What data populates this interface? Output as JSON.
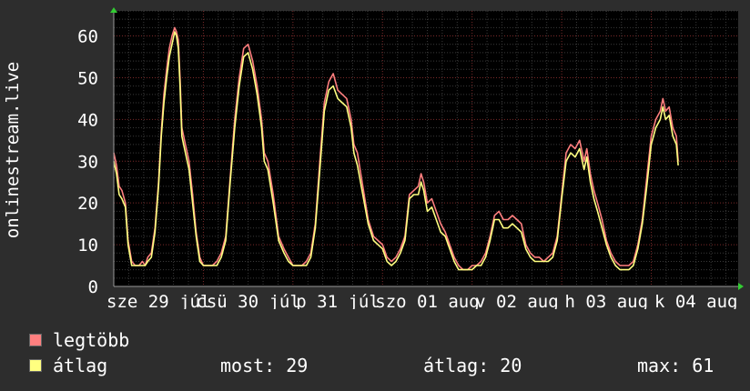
{
  "chart_data": {
    "type": "line",
    "ylabel": "onlinestream.live",
    "ylim": [
      0,
      66
    ],
    "yticks": [
      0,
      10,
      20,
      30,
      40,
      50,
      60
    ],
    "xticks": [
      {
        "label": "sze 29 júl",
        "at": 0.5
      },
      {
        "label": "csü 30 júl",
        "at": 1.5
      },
      {
        "label": "p 31 júl",
        "at": 2.5
      },
      {
        "label": "szo 01 aug",
        "at": 3.5
      },
      {
        "label": "v 02 aug",
        "at": 4.5
      },
      {
        "label": "h 03 aug",
        "at": 5.5
      },
      {
        "label": "k 04 aug",
        "at": 6.5
      }
    ],
    "xlim": [
      0,
      6.97
    ],
    "grid": true,
    "series": [
      {
        "name": "legtöbb",
        "color": "#ff7f7f",
        "points": [
          [
            0.0,
            32
          ],
          [
            0.03,
            29
          ],
          [
            0.06,
            24
          ],
          [
            0.09,
            23
          ],
          [
            0.13,
            20
          ],
          [
            0.16,
            11
          ],
          [
            0.2,
            6
          ],
          [
            0.24,
            5
          ],
          [
            0.28,
            5
          ],
          [
            0.32,
            6
          ],
          [
            0.35,
            5
          ],
          [
            0.38,
            7
          ],
          [
            0.42,
            8
          ],
          [
            0.46,
            14
          ],
          [
            0.5,
            25
          ],
          [
            0.53,
            37
          ],
          [
            0.56,
            46
          ],
          [
            0.59,
            52
          ],
          [
            0.62,
            57
          ],
          [
            0.65,
            60
          ],
          [
            0.68,
            62
          ],
          [
            0.7,
            61
          ],
          [
            0.72,
            59
          ],
          [
            0.74,
            50
          ],
          [
            0.76,
            38
          ],
          [
            0.8,
            34
          ],
          [
            0.84,
            30
          ],
          [
            0.88,
            22
          ],
          [
            0.92,
            13
          ],
          [
            0.96,
            7
          ],
          [
            1.0,
            5
          ],
          [
            1.05,
            5
          ],
          [
            1.1,
            5
          ],
          [
            1.15,
            6
          ],
          [
            1.2,
            8
          ],
          [
            1.25,
            12
          ],
          [
            1.3,
            26
          ],
          [
            1.35,
            40
          ],
          [
            1.4,
            50
          ],
          [
            1.45,
            57
          ],
          [
            1.5,
            58
          ],
          [
            1.55,
            54
          ],
          [
            1.6,
            48
          ],
          [
            1.65,
            40
          ],
          [
            1.68,
            32
          ],
          [
            1.72,
            30
          ],
          [
            1.78,
            22
          ],
          [
            1.84,
            12
          ],
          [
            1.9,
            9
          ],
          [
            1.95,
            7
          ],
          [
            2.0,
            5
          ],
          [
            2.05,
            5
          ],
          [
            2.1,
            5
          ],
          [
            2.15,
            6
          ],
          [
            2.2,
            8
          ],
          [
            2.25,
            15
          ],
          [
            2.3,
            30
          ],
          [
            2.35,
            44
          ],
          [
            2.4,
            49
          ],
          [
            2.45,
            51
          ],
          [
            2.5,
            47
          ],
          [
            2.55,
            46
          ],
          [
            2.6,
            45
          ],
          [
            2.65,
            40
          ],
          [
            2.68,
            34
          ],
          [
            2.72,
            32
          ],
          [
            2.78,
            24
          ],
          [
            2.84,
            16
          ],
          [
            2.9,
            12
          ],
          [
            2.95,
            11
          ],
          [
            3.0,
            10
          ],
          [
            3.05,
            7
          ],
          [
            3.1,
            6
          ],
          [
            3.15,
            7
          ],
          [
            3.2,
            9
          ],
          [
            3.25,
            12
          ],
          [
            3.3,
            22
          ],
          [
            3.35,
            23
          ],
          [
            3.4,
            24
          ],
          [
            3.43,
            27
          ],
          [
            3.46,
            25
          ],
          [
            3.5,
            20
          ],
          [
            3.55,
            21
          ],
          [
            3.6,
            18
          ],
          [
            3.65,
            15
          ],
          [
            3.7,
            13
          ],
          [
            3.75,
            10
          ],
          [
            3.8,
            7
          ],
          [
            3.85,
            5
          ],
          [
            3.9,
            4
          ],
          [
            3.95,
            4
          ],
          [
            4.0,
            5
          ],
          [
            4.05,
            5
          ],
          [
            4.1,
            6
          ],
          [
            4.15,
            8
          ],
          [
            4.2,
            12
          ],
          [
            4.25,
            17
          ],
          [
            4.3,
            18
          ],
          [
            4.35,
            16
          ],
          [
            4.4,
            16
          ],
          [
            4.45,
            17
          ],
          [
            4.5,
            16
          ],
          [
            4.55,
            15
          ],
          [
            4.6,
            10
          ],
          [
            4.65,
            8
          ],
          [
            4.7,
            7
          ],
          [
            4.75,
            7
          ],
          [
            4.8,
            6
          ],
          [
            4.85,
            7
          ],
          [
            4.9,
            8
          ],
          [
            4.95,
            12
          ],
          [
            5.0,
            22
          ],
          [
            5.05,
            32
          ],
          [
            5.1,
            34
          ],
          [
            5.15,
            33
          ],
          [
            5.2,
            35
          ],
          [
            5.25,
            30
          ],
          [
            5.28,
            33
          ],
          [
            5.32,
            27
          ],
          [
            5.36,
            23
          ],
          [
            5.4,
            20
          ],
          [
            5.45,
            16
          ],
          [
            5.5,
            11
          ],
          [
            5.55,
            8
          ],
          [
            5.6,
            6
          ],
          [
            5.65,
            5
          ],
          [
            5.7,
            5
          ],
          [
            5.75,
            5
          ],
          [
            5.8,
            6
          ],
          [
            5.85,
            10
          ],
          [
            5.9,
            16
          ],
          [
            5.95,
            26
          ],
          [
            6.0,
            36
          ],
          [
            6.05,
            40
          ],
          [
            6.1,
            42
          ],
          [
            6.13,
            45
          ],
          [
            6.16,
            42
          ],
          [
            6.2,
            43
          ],
          [
            6.24,
            38
          ],
          [
            6.28,
            36
          ],
          [
            6.3,
            30
          ]
        ]
      },
      {
        "name": "átlag",
        "color": "#ffff80",
        "points": [
          [
            0.0,
            30
          ],
          [
            0.03,
            27
          ],
          [
            0.06,
            22
          ],
          [
            0.09,
            21
          ],
          [
            0.13,
            19
          ],
          [
            0.16,
            10
          ],
          [
            0.2,
            5
          ],
          [
            0.24,
            5
          ],
          [
            0.28,
            5
          ],
          [
            0.32,
            5
          ],
          [
            0.35,
            5
          ],
          [
            0.38,
            6
          ],
          [
            0.42,
            7
          ],
          [
            0.46,
            13
          ],
          [
            0.5,
            24
          ],
          [
            0.53,
            36
          ],
          [
            0.56,
            44
          ],
          [
            0.59,
            50
          ],
          [
            0.62,
            55
          ],
          [
            0.65,
            58
          ],
          [
            0.68,
            61
          ],
          [
            0.7,
            60
          ],
          [
            0.72,
            57
          ],
          [
            0.74,
            48
          ],
          [
            0.76,
            36
          ],
          [
            0.8,
            32
          ],
          [
            0.84,
            28
          ],
          [
            0.88,
            20
          ],
          [
            0.92,
            12
          ],
          [
            0.96,
            6
          ],
          [
            1.0,
            5
          ],
          [
            1.05,
            5
          ],
          [
            1.1,
            5
          ],
          [
            1.15,
            5
          ],
          [
            1.2,
            7
          ],
          [
            1.25,
            11
          ],
          [
            1.3,
            25
          ],
          [
            1.35,
            38
          ],
          [
            1.4,
            48
          ],
          [
            1.45,
            55
          ],
          [
            1.5,
            56
          ],
          [
            1.55,
            52
          ],
          [
            1.6,
            46
          ],
          [
            1.65,
            38
          ],
          [
            1.68,
            30
          ],
          [
            1.72,
            28
          ],
          [
            1.78,
            20
          ],
          [
            1.84,
            11
          ],
          [
            1.9,
            8
          ],
          [
            1.95,
            6
          ],
          [
            2.0,
            5
          ],
          [
            2.05,
            5
          ],
          [
            2.1,
            5
          ],
          [
            2.15,
            5
          ],
          [
            2.2,
            7
          ],
          [
            2.25,
            14
          ],
          [
            2.3,
            28
          ],
          [
            2.35,
            42
          ],
          [
            2.4,
            47
          ],
          [
            2.45,
            48
          ],
          [
            2.5,
            45
          ],
          [
            2.55,
            44
          ],
          [
            2.6,
            43
          ],
          [
            2.65,
            38
          ],
          [
            2.68,
            32
          ],
          [
            2.72,
            29
          ],
          [
            2.78,
            22
          ],
          [
            2.84,
            15
          ],
          [
            2.9,
            11
          ],
          [
            2.95,
            10
          ],
          [
            3.0,
            9
          ],
          [
            3.05,
            6
          ],
          [
            3.1,
            5
          ],
          [
            3.15,
            6
          ],
          [
            3.2,
            8
          ],
          [
            3.25,
            11
          ],
          [
            3.3,
            21
          ],
          [
            3.35,
            22
          ],
          [
            3.4,
            22
          ],
          [
            3.43,
            25
          ],
          [
            3.46,
            23
          ],
          [
            3.5,
            18
          ],
          [
            3.55,
            19
          ],
          [
            3.6,
            16
          ],
          [
            3.65,
            13
          ],
          [
            3.7,
            12
          ],
          [
            3.75,
            9
          ],
          [
            3.8,
            6
          ],
          [
            3.85,
            4
          ],
          [
            3.9,
            4
          ],
          [
            3.95,
            4
          ],
          [
            4.0,
            4
          ],
          [
            4.05,
            5
          ],
          [
            4.1,
            5
          ],
          [
            4.15,
            7
          ],
          [
            4.2,
            11
          ],
          [
            4.25,
            16
          ],
          [
            4.3,
            16
          ],
          [
            4.35,
            14
          ],
          [
            4.4,
            14
          ],
          [
            4.45,
            15
          ],
          [
            4.5,
            14
          ],
          [
            4.55,
            13
          ],
          [
            4.6,
            9
          ],
          [
            4.65,
            7
          ],
          [
            4.7,
            6
          ],
          [
            4.75,
            6
          ],
          [
            4.8,
            6
          ],
          [
            4.85,
            6
          ],
          [
            4.9,
            7
          ],
          [
            4.95,
            11
          ],
          [
            5.0,
            21
          ],
          [
            5.05,
            30
          ],
          [
            5.1,
            32
          ],
          [
            5.15,
            31
          ],
          [
            5.2,
            33
          ],
          [
            5.25,
            28
          ],
          [
            5.28,
            31
          ],
          [
            5.32,
            25
          ],
          [
            5.36,
            21
          ],
          [
            5.4,
            18
          ],
          [
            5.45,
            14
          ],
          [
            5.5,
            10
          ],
          [
            5.55,
            7
          ],
          [
            5.6,
            5
          ],
          [
            5.65,
            4
          ],
          [
            5.7,
            4
          ],
          [
            5.75,
            4
          ],
          [
            5.8,
            5
          ],
          [
            5.85,
            9
          ],
          [
            5.9,
            15
          ],
          [
            5.95,
            24
          ],
          [
            6.0,
            34
          ],
          [
            6.05,
            38
          ],
          [
            6.1,
            40
          ],
          [
            6.13,
            43
          ],
          [
            6.16,
            40
          ],
          [
            6.2,
            41
          ],
          [
            6.24,
            36
          ],
          [
            6.28,
            34
          ],
          [
            6.3,
            29
          ]
        ]
      }
    ]
  },
  "legend": [
    {
      "label": "legtöbb",
      "color": "#ff7f7f"
    },
    {
      "label": "átlag",
      "color": "#ffff80"
    }
  ],
  "stats": {
    "now": "most: 29",
    "avg": "átlag: 20",
    "max": "max: 61"
  }
}
